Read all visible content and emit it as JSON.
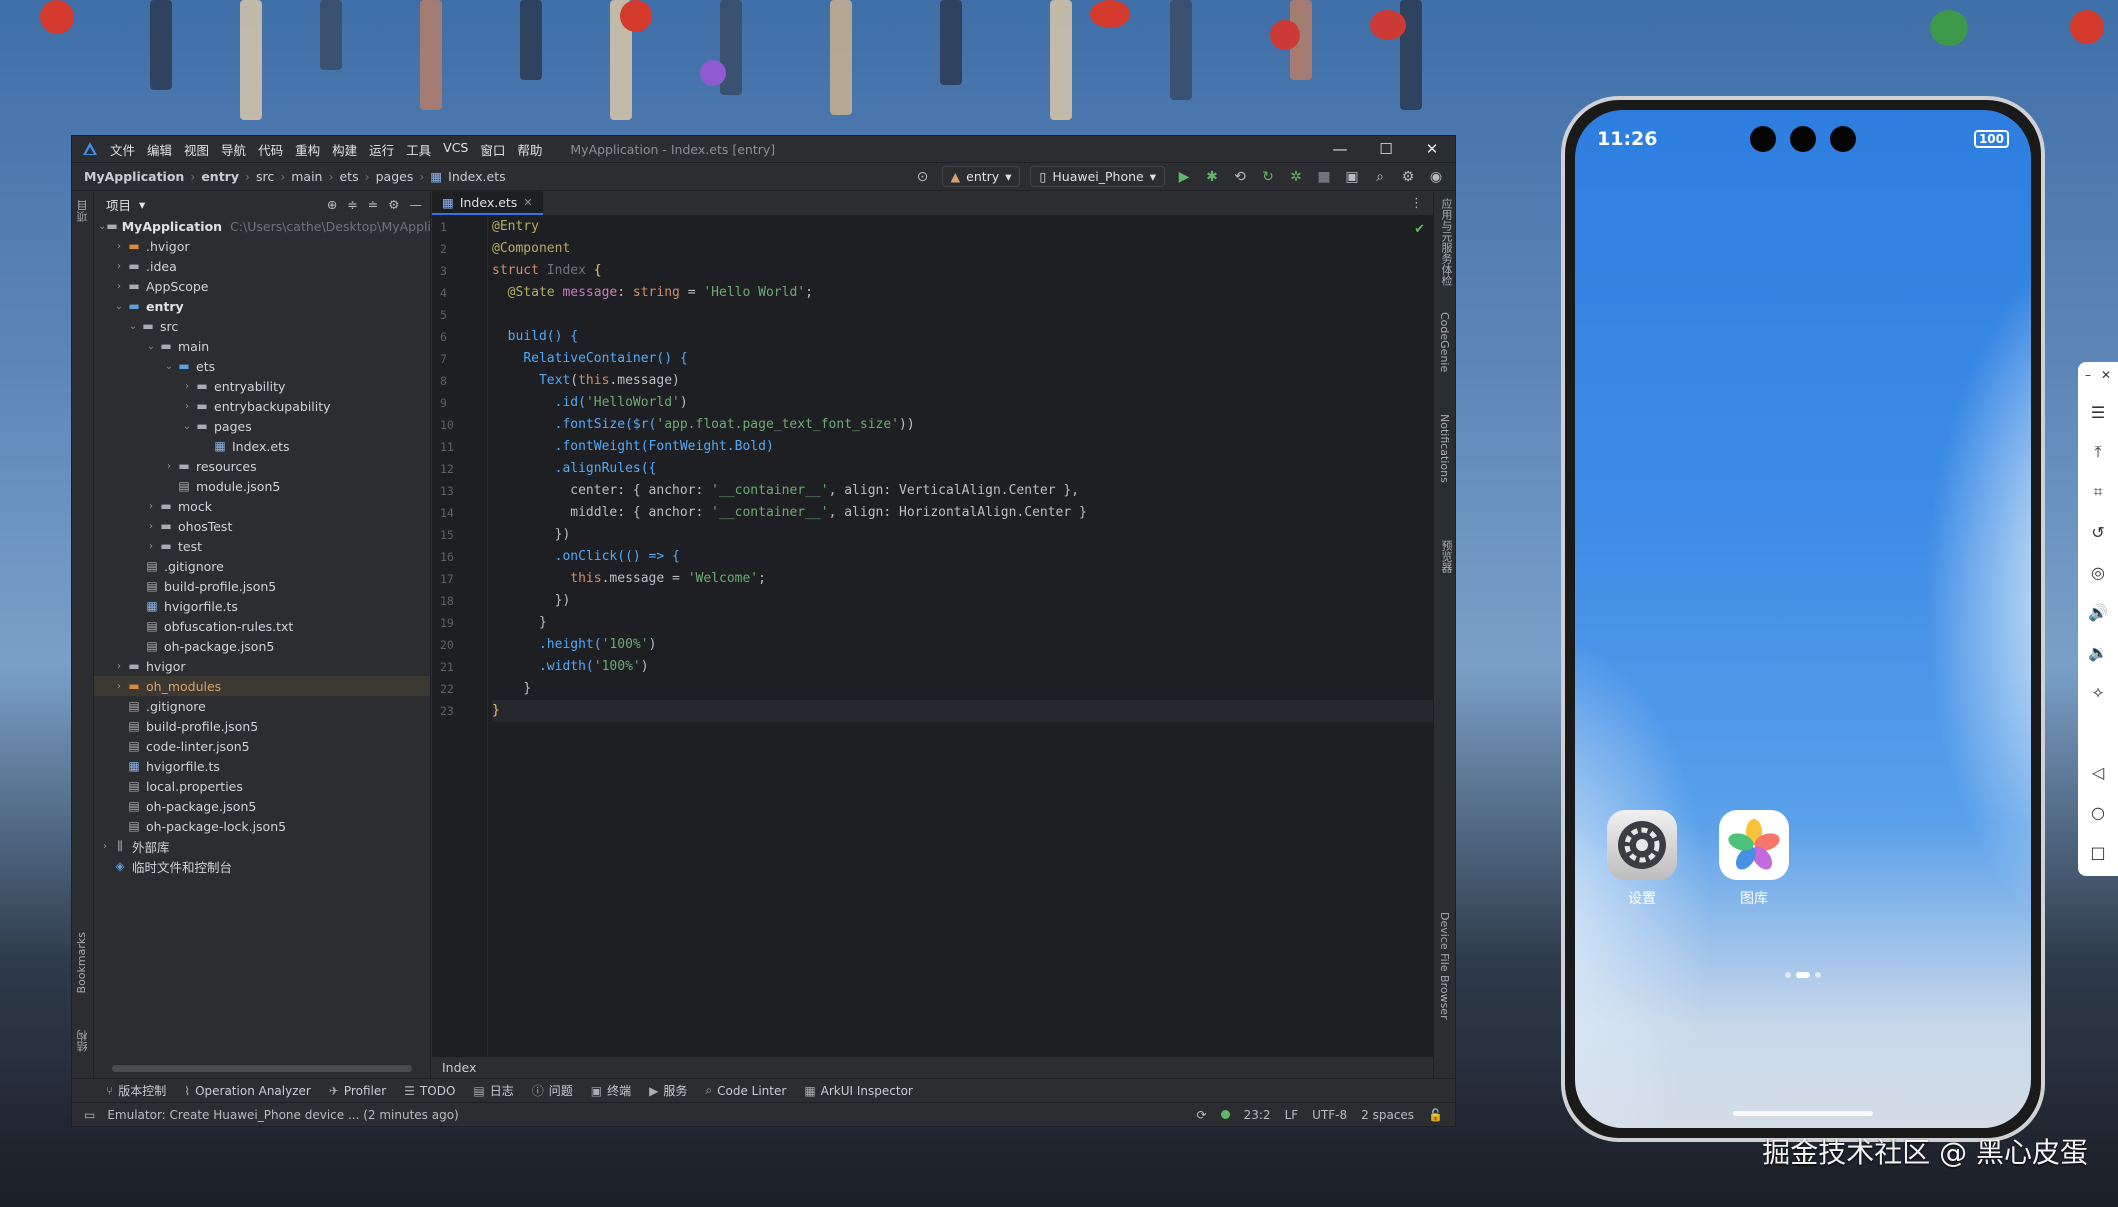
{
  "ide": {
    "menu": [
      "文件",
      "编辑",
      "视图",
      "导航",
      "代码",
      "重构",
      "构建",
      "运行",
      "工具",
      "VCS",
      "窗口",
      "帮助"
    ],
    "window_title": "MyApplication - Index.ets [entry]",
    "window_controls": [
      "—",
      "☐",
      "✕"
    ],
    "breadcrumb": [
      "MyApplication",
      "entry",
      "src",
      "main",
      "ets",
      "pages",
      "Index.ets"
    ],
    "run_config": "entry",
    "device": "Huawei_Phone",
    "left_strip_labels": [
      "项目",
      "Bookmarks",
      "结构"
    ],
    "right_strip_labels": [
      "应用与元服务体检",
      "CodeGenie",
      "Notifications",
      "预览器",
      "Device File Browser"
    ],
    "project": {
      "title": "项目",
      "root_name": "MyApplication",
      "root_path": "C:\\Users\\cathe\\Desktop\\MyApplica",
      "items": [
        {
          "label": ".hvigor"
        },
        {
          "label": ".idea"
        },
        {
          "label": "AppScope"
        },
        {
          "label": "entry"
        },
        {
          "label": "src"
        },
        {
          "label": "main"
        },
        {
          "label": "ets"
        },
        {
          "label": "entryability"
        },
        {
          "label": "entrybackupability"
        },
        {
          "label": "pages"
        },
        {
          "label": "Index.ets"
        },
        {
          "label": "resources"
        },
        {
          "label": "module.json5"
        },
        {
          "label": "mock"
        },
        {
          "label": "ohosTest"
        },
        {
          "label": "test"
        },
        {
          "label": ".gitignore"
        },
        {
          "label": "build-profile.json5"
        },
        {
          "label": "hvigorfile.ts"
        },
        {
          "label": "obfuscation-rules.txt"
        },
        {
          "label": "oh-package.json5"
        },
        {
          "label": "hvigor"
        },
        {
          "label": "oh_modules"
        },
        {
          "label": ".gitignore"
        },
        {
          "label": "build-profile.json5"
        },
        {
          "label": "code-linter.json5"
        },
        {
          "label": "hvigorfile.ts"
        },
        {
          "label": "local.properties"
        },
        {
          "label": "oh-package.json5"
        },
        {
          "label": "oh-package-lock.json5"
        },
        {
          "label": "外部库"
        },
        {
          "label": "临时文件和控制台"
        }
      ]
    },
    "editor": {
      "tab": "Index.ets",
      "footer": "Index",
      "line_numbers": [
        "1",
        "2",
        "3",
        "4",
        "5",
        "6",
        "7",
        "8",
        "9",
        "10",
        "11",
        "12",
        "13",
        "14",
        "15",
        "16",
        "17",
        "18",
        "19",
        "20",
        "21",
        "22",
        "23"
      ]
    },
    "code": {
      "l1": "@Entry",
      "l2": "@Component",
      "l3_kw": "struct",
      "l3_name": "Index",
      "l3_brace": "{",
      "l4_dec": "@State",
      "l4_name": "message",
      "l4_type": "string",
      "l4_val": "'Hello World'",
      "l6": "build() {",
      "l7": "RelativeContainer() {",
      "l8_fn": "Text",
      "l8_this": "this",
      "l8_rest": ".message)",
      "l9_fn": ".id(",
      "l9_str": "'HelloWorld'",
      "l10_fn": ".fontSize($r(",
      "l10_str": "'app.float.page_text_font_size'",
      "l11": ".fontWeight(FontWeight.Bold)",
      "l12": ".alignRules({",
      "l13_a": "center: { anchor: ",
      "l13_s": "'__container__'",
      "l13_b": ", align: VerticalAlign.Center },",
      "l14_a": "middle: { anchor: ",
      "l14_s": "'__container__'",
      "l14_b": ", align: HorizontalAlign.Center }",
      "l15": "})",
      "l16": ".onClick(() => {",
      "l17_this": "this",
      "l17_a": ".message = ",
      "l17_s": "'Welcome'",
      "l17_end": ";",
      "l18": "})",
      "l19": "}",
      "l20_fn": ".height(",
      "l20_s": "'100%'",
      "l21_fn": ".width(",
      "l21_s": "'100%'",
      "l22": "}",
      "l23": "}"
    },
    "toolwindows": [
      "版本控制",
      "Operation Analyzer",
      "Profiler",
      "TODO",
      "日志",
      "问题",
      "终端",
      "服务",
      "Code Linter",
      "ArkUI Inspector"
    ],
    "status": {
      "message": "Emulator: Create Huawei_Phone device ... (2 minutes ago)",
      "position": "23:2",
      "line_sep": "LF",
      "encoding": "UTF-8",
      "indent": "2 spaces"
    }
  },
  "phone": {
    "time": "11:26",
    "battery": "100",
    "apps": [
      {
        "label": "设置",
        "icon": "settings-gear-icon"
      },
      {
        "label": "图库",
        "icon": "gallery-flower-icon"
      }
    ]
  },
  "watermark": "掘金技术社区 @ 黑心皮蛋"
}
